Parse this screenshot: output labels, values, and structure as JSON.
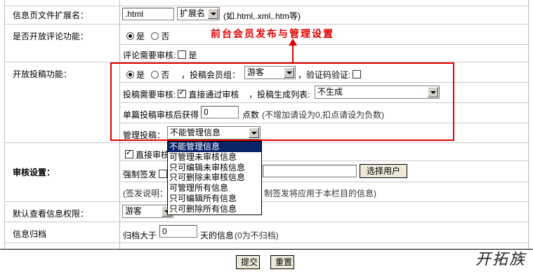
{
  "rows": {
    "ext": {
      "label": "信息页文件扩展名：",
      "value": ".html",
      "select": "扩展名",
      "hint": "(如.html,.xml,.htm等)"
    },
    "comment": {
      "label": "是否开放评论功能：",
      "yes": "是",
      "no": "否",
      "audit_label": "评论需要审核:",
      "audit_yes": "是"
    },
    "submit": {
      "label": "开放投稿功能：",
      "yes": "是",
      "no": "否",
      "group_label": "，投稿会员组：",
      "group_value": "游客",
      "captcha_label": "，验证码验证:",
      "audit_label": "投稿需要审核:",
      "direct_label": "直接通过审核",
      "list_label": "，投稿生成列表:",
      "list_value": "不生成",
      "score_label": "单篇投稿审核后获得",
      "score_value": "0",
      "score_unit": "点数",
      "score_hint": "(不增加请设为0,扣点请设为负数)",
      "manage_label": "管理投稿：",
      "manage_value": "不能管理信息"
    },
    "audit": {
      "label": "审核设置：",
      "direct_label": "直接审核",
      "force_label": "强制签发",
      "select_user": "选择用户",
      "note_prefix": "(签发说明：",
      "note_suffix": "制签发将应用于本栏目的信息)"
    },
    "view": {
      "label": "默认查看信息权限：",
      "value": "游客"
    },
    "archive": {
      "label": "信息归档",
      "prefix": "归档大于",
      "value": "0",
      "suffix": "天的信息",
      "hint": "(0为不归档)"
    }
  },
  "annotation": "前台会员发布与管理设置",
  "dropdown_options": [
    "不能管理信息",
    "可管理未审核信息",
    "只可编辑未审核信息",
    "只可删除未审核信息",
    "可管理所有信息",
    "只可编辑所有信息",
    "只可删除所有信息"
  ],
  "buttons": {
    "submit": "提交",
    "reset": "重置"
  },
  "logo": "开拓族",
  "colors": {
    "annotation_red": "#e00000",
    "selected_bg": "#0a246a"
  }
}
